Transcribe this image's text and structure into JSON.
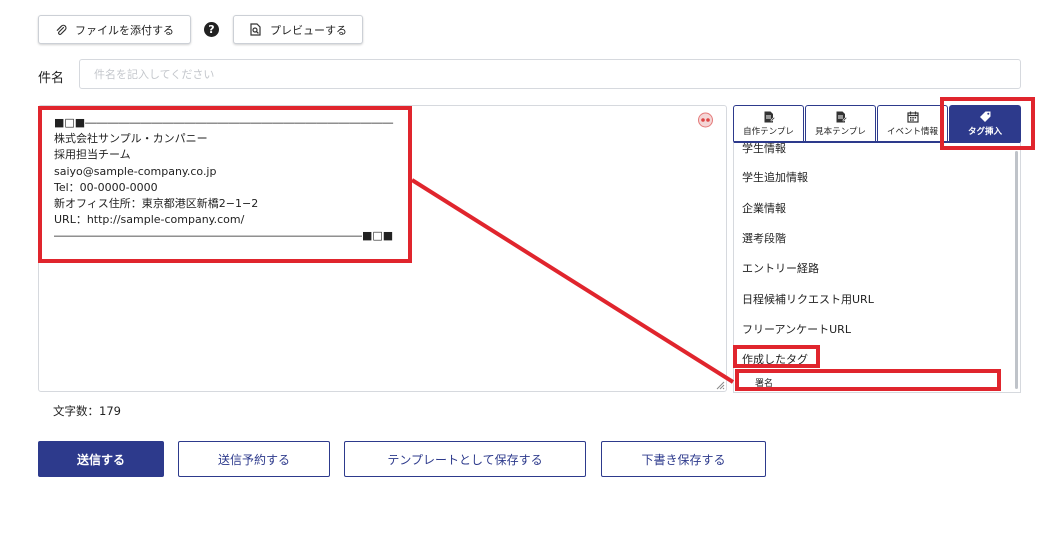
{
  "toolbar": {
    "attach_label": "ファイルを添付する",
    "preview_label": "プレビューする"
  },
  "subject": {
    "label": "件名",
    "placeholder": "件名を記入してください"
  },
  "signature": {
    "lines": [
      "■□■――――――――――――――――――――――――――――",
      "株式会社サンプル・カンパニー",
      "採用担当チーム",
      "saiyo@sample-company.co.jp",
      "Tel：00-0000-0000",
      "新オフィス住所：東京都港区新橋2−1−2",
      "URL：http://sample-company.com/",
      "――――――――――――――――――――――――――――■□■"
    ]
  },
  "tabs": [
    {
      "label": "自作テンプレ",
      "icon": "document-edit-icon"
    },
    {
      "label": "見本テンプレ",
      "icon": "document-edit-icon"
    },
    {
      "label": "イベント情報",
      "icon": "calendar-icon"
    },
    {
      "label": "タグ挿入",
      "icon": "tag-icon"
    }
  ],
  "tag_panel": {
    "items": [
      "学生情報",
      "学生追加情報",
      "企業情報",
      "選考段階",
      "エントリー経路",
      "日程候補リクエスト用URL",
      "フリーアンケートURL",
      "作成したタグ"
    ],
    "sub_item": "署名"
  },
  "char_count": {
    "label": "文字数：179"
  },
  "actions": {
    "send": "送信する",
    "schedule": "送信予約する",
    "save_template": "テンプレートとして保存する",
    "save_draft": "下書き保存する"
  },
  "colors": {
    "primary": "#2d3a8c",
    "highlight": "#e0252d"
  }
}
